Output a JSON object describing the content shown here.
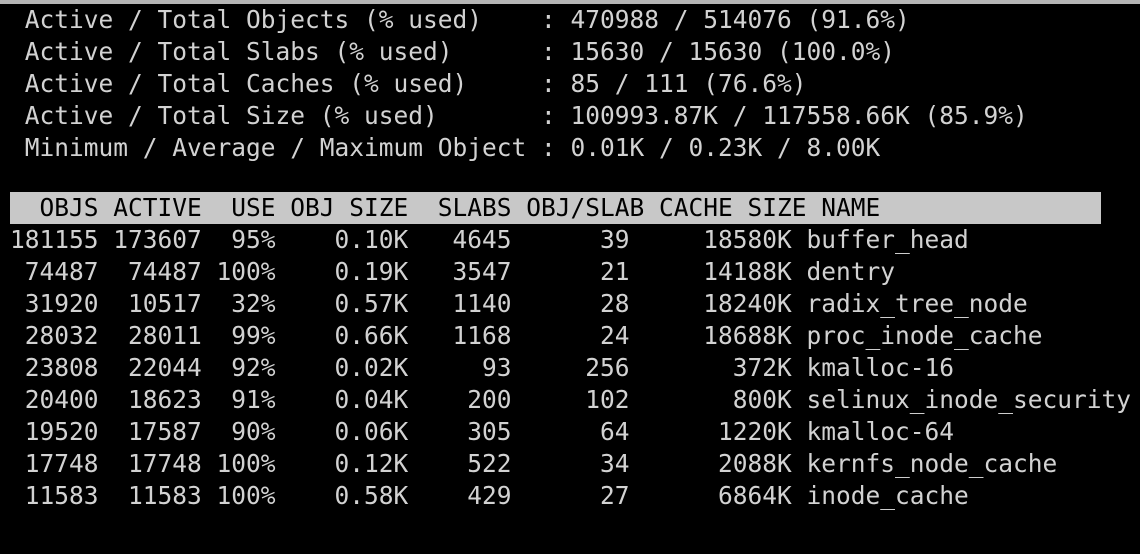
{
  "terminal": {
    "program": "slabtop",
    "background_color": "#000000",
    "foreground_color": "#d2d2d2",
    "header_bar_background": "#c8c8c8",
    "header_bar_foreground": "#000000"
  },
  "summary": {
    "rows": [
      {
        "label": "Active / Total Objects (% used)",
        "separator": ":",
        "value": "470988 / 514076 (91.6%)",
        "active": "470988",
        "total": "514076",
        "percent_used": "91.6%"
      },
      {
        "label": "Active / Total Slabs (% used)",
        "separator": ":",
        "value": "15630 / 15630 (100.0%)",
        "active": "15630",
        "total": "15630",
        "percent_used": "100.0%"
      },
      {
        "label": "Active / Total Caches (% used)",
        "separator": ":",
        "value": "85 / 111 (76.6%)",
        "active": "85",
        "total": "111",
        "percent_used": "76.6%"
      },
      {
        "label": "Active / Total Size (% used)",
        "separator": ":",
        "value": "100993.87K / 117558.66K (85.9%)",
        "active": "100993.87K",
        "total": "117558.66K",
        "percent_used": "85.9%"
      },
      {
        "label": "Minimum / Average / Maximum Object",
        "separator": ":",
        "value": "0.01K / 0.23K / 8.00K",
        "minimum": "0.01K",
        "average": "0.23K",
        "maximum": "8.00K"
      }
    ],
    "lines": [
      " Active / Total Objects (% used)    : 470988 / 514076 (91.6%)",
      " Active / Total Slabs (% used)      : 15630 / 15630 (100.0%)",
      " Active / Total Caches (% used)     : 85 / 111 (76.6%)",
      " Active / Total Size (% used)       : 100993.87K / 117558.66K (85.9%)",
      " Minimum / Average / Maximum Object : 0.01K / 0.23K / 8.00K"
    ]
  },
  "table": {
    "header_line": "  OBJS ACTIVE  USE OBJ SIZE  SLABS OBJ/SLAB CACHE SIZE NAME                    ",
    "columns": [
      "OBJS",
      "ACTIVE",
      "USE",
      "OBJ SIZE",
      "SLABS",
      "OBJ/SLAB",
      "CACHE SIZE",
      "NAME"
    ],
    "rows": [
      {
        "objs": "181155",
        "active": "173607",
        "use": "95%",
        "obj_size": "0.10K",
        "slabs": "4645",
        "obj_per_slab": "39",
        "cache_size": "18580K",
        "name": "buffer_head",
        "line": "181155 173607  95%    0.10K   4645      39     18580K buffer_head"
      },
      {
        "objs": "74487",
        "active": "74487",
        "use": "100%",
        "obj_size": "0.19K",
        "slabs": "3547",
        "obj_per_slab": "21",
        "cache_size": "14188K",
        "name": "dentry",
        "line": " 74487  74487 100%    0.19K   3547      21     14188K dentry"
      },
      {
        "objs": "31920",
        "active": "10517",
        "use": "32%",
        "obj_size": "0.57K",
        "slabs": "1140",
        "obj_per_slab": "28",
        "cache_size": "18240K",
        "name": "radix_tree_node",
        "line": " 31920  10517  32%    0.57K   1140      28     18240K radix_tree_node"
      },
      {
        "objs": "28032",
        "active": "28011",
        "use": "99%",
        "obj_size": "0.66K",
        "slabs": "1168",
        "obj_per_slab": "24",
        "cache_size": "18688K",
        "name": "proc_inode_cache",
        "line": " 28032  28011  99%    0.66K   1168      24     18688K proc_inode_cache"
      },
      {
        "objs": "23808",
        "active": "22044",
        "use": "92%",
        "obj_size": "0.02K",
        "slabs": "93",
        "obj_per_slab": "256",
        "cache_size": "372K",
        "name": "kmalloc-16",
        "line": " 23808  22044  92%    0.02K     93     256       372K kmalloc-16"
      },
      {
        "objs": "20400",
        "active": "18623",
        "use": "91%",
        "obj_size": "0.04K",
        "slabs": "200",
        "obj_per_slab": "102",
        "cache_size": "800K",
        "name": "selinux_inode_security",
        "line": " 20400  18623  91%    0.04K    200     102       800K selinux_inode_security"
      },
      {
        "objs": "19520",
        "active": "17587",
        "use": "90%",
        "obj_size": "0.06K",
        "slabs": "305",
        "obj_per_slab": "64",
        "cache_size": "1220K",
        "name": "kmalloc-64",
        "line": " 19520  17587  90%    0.06K    305      64      1220K kmalloc-64"
      },
      {
        "objs": "17748",
        "active": "17748",
        "use": "100%",
        "obj_size": "0.12K",
        "slabs": "522",
        "obj_per_slab": "34",
        "cache_size": "2088K",
        "name": "kernfs_node_cache",
        "line": " 17748  17748 100%    0.12K    522      34      2088K kernfs_node_cache"
      },
      {
        "objs": "11583",
        "active": "11583",
        "use": "100%",
        "obj_size": "0.58K",
        "slabs": "429",
        "obj_per_slab": "27",
        "cache_size": "6864K",
        "name": "inode_cache",
        "line": " 11583  11583 100%    0.58K    429      27      6864K inode_cache"
      }
    ]
  }
}
